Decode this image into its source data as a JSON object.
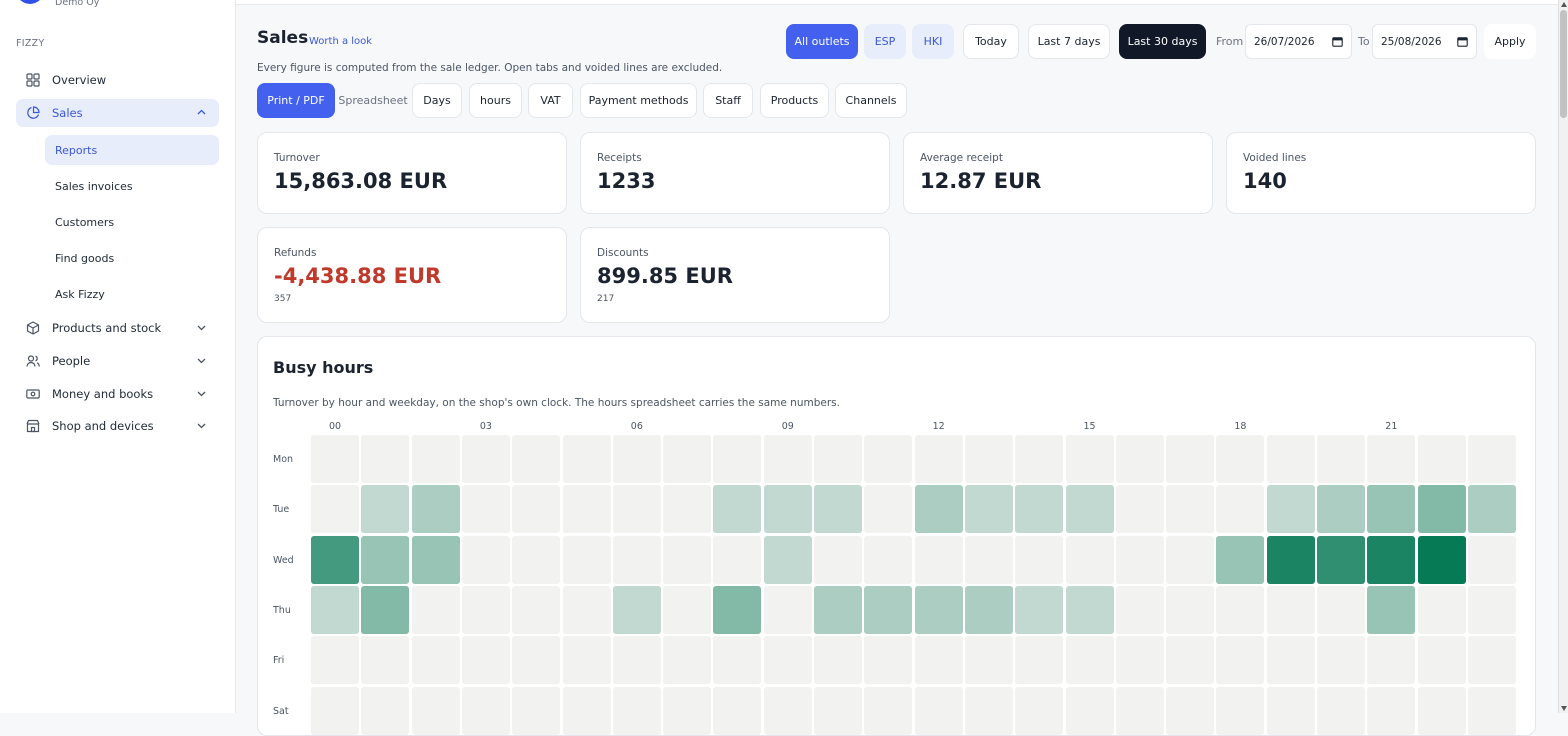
{
  "org": {
    "name": "Demo Oy"
  },
  "sidebar": {
    "section_label": "FIZZY",
    "items": [
      {
        "label": "Overview",
        "icon": "grid-icon"
      },
      {
        "label": "Sales",
        "icon": "pie-chart-icon"
      },
      {
        "label": "Products and stock",
        "icon": "box-icon"
      },
      {
        "label": "People",
        "icon": "users-icon"
      },
      {
        "label": "Money and books",
        "icon": "banknote-icon"
      },
      {
        "label": "Shop and devices",
        "icon": "store-icon"
      }
    ],
    "sales_subitems": [
      {
        "label": "Reports"
      },
      {
        "label": "Sales invoices"
      },
      {
        "label": "Customers"
      },
      {
        "label": "Find goods"
      },
      {
        "label": "Ask Fizzy"
      }
    ]
  },
  "header": {
    "title": "Sales",
    "link": "Worth a look",
    "subtitle": "Every figure is computed from the sale ledger. Open tabs and voided lines are excluded."
  },
  "filters": {
    "outlets": [
      {
        "label": "All outlets",
        "selected": true
      },
      {
        "label": "ESP"
      },
      {
        "label": "HKI"
      }
    ],
    "ranges": [
      {
        "label": "Today"
      },
      {
        "label": "Last 7 days"
      },
      {
        "label": "Last 30 days",
        "selected": true
      }
    ],
    "from_label": "From",
    "from_value": "26/07/2026",
    "to_label": "To",
    "to_value": "25/08/2026",
    "apply_label": "Apply"
  },
  "exports": {
    "print_label": "Print / PDF",
    "spreadsheet_label": "Spreadsheet",
    "sheets": [
      "Days",
      "hours",
      "VAT",
      "Payment methods",
      "Staff",
      "Products",
      "Channels"
    ]
  },
  "stats": [
    {
      "label": "Turnover",
      "value": "15,863.08 EUR"
    },
    {
      "label": "Receipts",
      "value": "1233"
    },
    {
      "label": "Average receipt",
      "value": "12.87 EUR"
    },
    {
      "label": "Voided lines",
      "value": "140"
    },
    {
      "label": "Refunds",
      "value": "-4,438.88 EUR",
      "sub": "357",
      "negative": true
    },
    {
      "label": "Discounts",
      "value": "899.85 EUR",
      "sub": "217"
    }
  ],
  "busy_hours": {
    "title": "Busy hours",
    "description": "Turnover by hour and weekday, on the shop's own clock. The hours spreadsheet carries the same numbers.",
    "hour_labels": [
      {
        "hour": 0,
        "label": "00"
      },
      {
        "hour": 3,
        "label": "03"
      },
      {
        "hour": 6,
        "label": "06"
      },
      {
        "hour": 9,
        "label": "09"
      },
      {
        "hour": 12,
        "label": "12"
      },
      {
        "hour": 15,
        "label": "15"
      },
      {
        "hour": 18,
        "label": "18"
      },
      {
        "hour": 21,
        "label": "21"
      }
    ],
    "days": [
      "Mon",
      "Tue",
      "Wed",
      "Thu",
      "Fri",
      "Sat"
    ],
    "intensity": [
      [
        0,
        0,
        0,
        0,
        0,
        0,
        0,
        0,
        0,
        0,
        0,
        0,
        0,
        0,
        0,
        0,
        0,
        0,
        0,
        0,
        0,
        0,
        0,
        0
      ],
      [
        0,
        1,
        2,
        0,
        0,
        0,
        0,
        0,
        1,
        1,
        1,
        0,
        2,
        1,
        1,
        1,
        0,
        0,
        0,
        1,
        2,
        3,
        4,
        2
      ],
      [
        7,
        3,
        3,
        0,
        0,
        0,
        0,
        0,
        0,
        1,
        0,
        0,
        0,
        0,
        0,
        0,
        0,
        0,
        3,
        9,
        8,
        9,
        10,
        0
      ],
      [
        1,
        4,
        0,
        0,
        0,
        0,
        1,
        0,
        4,
        0,
        2,
        2,
        2,
        2,
        1,
        1,
        0,
        0,
        0,
        0,
        0,
        3,
        0,
        0
      ],
      [
        0,
        0,
        0,
        0,
        0,
        0,
        0,
        0,
        0,
        0,
        0,
        0,
        0,
        0,
        0,
        0,
        0,
        0,
        0,
        0,
        0,
        0,
        0,
        0
      ],
      [
        0,
        0,
        0,
        0,
        0,
        0,
        0,
        0,
        0,
        0,
        0,
        0,
        0,
        0,
        0,
        0,
        0,
        0,
        0,
        0,
        0,
        0,
        0,
        0
      ]
    ],
    "scale_max": 10,
    "colors": {
      "empty": "#f2f2f0",
      "high": "#067a55"
    }
  }
}
